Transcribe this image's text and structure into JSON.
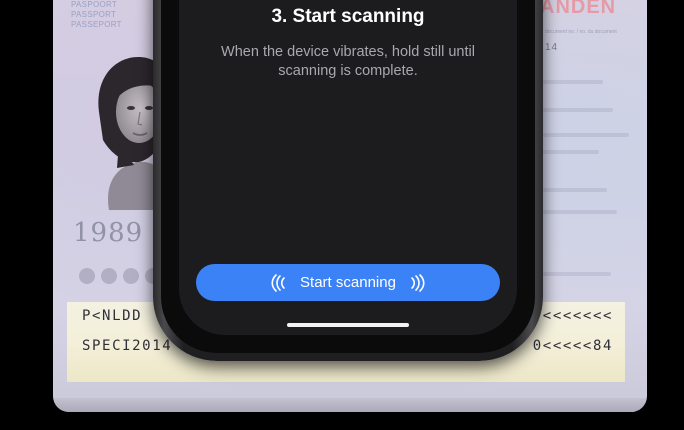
{
  "passport": {
    "heading_lines": [
      "PASPOORT",
      "PASSPORT",
      "PASSEPORT"
    ],
    "country": "ANDEN",
    "docno_label": "document no. / no. du document",
    "docno_value": "14",
    "year": "1989",
    "mrz_line1_start": "P<NLDD",
    "mrz_line1_end": "<<<<<<<",
    "mrz_line2_start": "SPECI2014",
    "mrz_line2_end": "0<<<<<84"
  },
  "screen": {
    "title": "3. Start scanning",
    "description": "When the device vibrates, hold still until scanning is complete.",
    "scan_button_label": "Start scanning"
  },
  "colors": {
    "accent": "#3b82f6",
    "screen_background": "#1c1c1e",
    "page_background": "#000000"
  },
  "icons": {
    "left": "nfc-wave-left-icon",
    "right": "nfc-wave-right-icon"
  }
}
